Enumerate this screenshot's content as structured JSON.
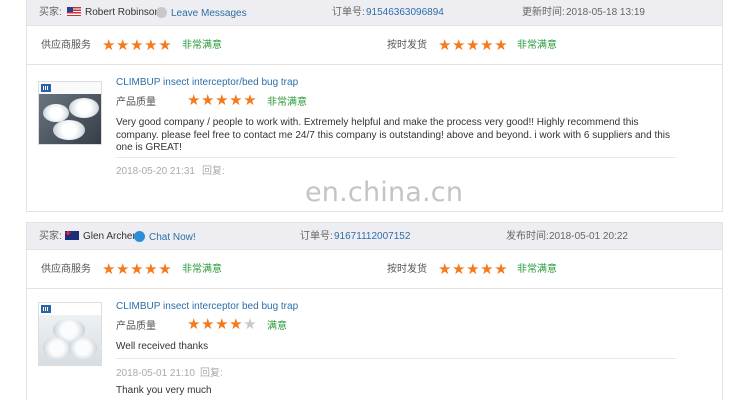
{
  "labels": {
    "buyer": "买家:",
    "order_no": "订单号:",
    "updated": "更新时间:",
    "published": "发布时间:",
    "supplier_service": "供应商服务",
    "on_time_delivery": "按时发货",
    "product_quality": "产品质量",
    "reply": "回复:"
  },
  "watermark": "en.china.cn",
  "colors": {
    "star_on": "#f47a1e",
    "star_off": "#c9c9c9",
    "rating_text": "#2a9a3a",
    "link": "#2d6ea8",
    "header_bg": "#eeeef2"
  },
  "reviews": [
    {
      "buyer_name": "Robert Robinson",
      "buyer_flag": "us-flag-icon",
      "contact_icon": "grey-status-dot-icon",
      "contact_label": "Leave Messages",
      "order_no": "91546363096894",
      "date_label_key": "updated",
      "date": "2018-05-18 13:19",
      "supplier_service_stars": 5,
      "supplier_service_text": "非常满意",
      "on_time_delivery_stars": 5,
      "on_time_delivery_text": "非常满意",
      "product_title": "CLIMBUP insect interceptor/bed bug trap",
      "product_quality_stars": 5,
      "product_quality_text": "非常满意",
      "comment": "Very good company / people to work with. Extremely helpful and make the process very good!! Highly recommend this company. please feel free to contact me 24/7 this company is outstanding! above and beyond. i work with 6 suppliers and this one is GREAT!",
      "comment_date": "2018-05-20 21:31",
      "reply_text": ""
    },
    {
      "buyer_name": "Glen Archer",
      "buyer_flag": "au-flag-icon",
      "contact_icon": "blue-chat-dot-icon",
      "contact_label": "Chat Now!",
      "order_no": "91671112007152",
      "date_label_key": "published",
      "date": "2018-05-01 20:22",
      "supplier_service_stars": 5,
      "supplier_service_text": "非常满意",
      "on_time_delivery_stars": 5,
      "on_time_delivery_text": "非常满意",
      "product_title": "CLIMBUP insect interceptor bed bug trap",
      "product_quality_stars": 4,
      "product_quality_text": "满意",
      "comment": "Well received thanks",
      "comment_date": "2018-05-01 21:10",
      "reply_text": "Thank you very much"
    }
  ]
}
